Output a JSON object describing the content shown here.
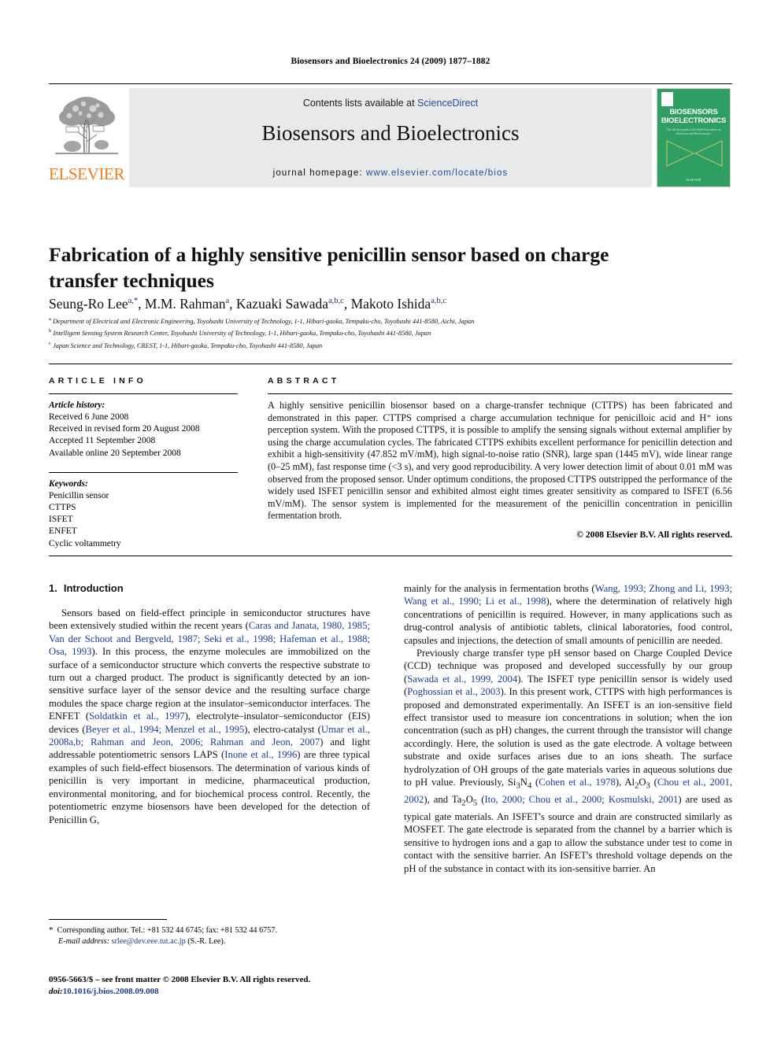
{
  "running_head": "Biosensors and Bioelectronics 24 (2009) 1877–1882",
  "masthead": {
    "publisher_name": "ELSEVIER",
    "contents_prefix": "Contents lists available at ",
    "contents_link": "ScienceDirect",
    "journal_title": "Biosensors and Bioelectronics",
    "homepage_prefix": "journal homepage: ",
    "homepage_url": "www.elsevier.com/locate/bios",
    "cover": {
      "title_line1": "BIOSENSORS",
      "title_amp": "&",
      "title_line2": "BIOELECTRONICS",
      "subtitle": "The official journal of the World Association on Biosensors and Bioelectronics",
      "footer": "ELSEVIER",
      "background_color": "#2f9e63"
    },
    "accent_orange": "#F07D18",
    "link_blue": "#1a4f9c"
  },
  "article": {
    "title": "Fabrication of a highly sensitive penicillin sensor based on charge transfer techniques",
    "authors_html": "Seung-Ro Lee<sup>a,*</sup>, M.M. Rahman<sup>a</sup>, Kazuaki Sawada<sup>a,b,c</sup>, Makoto Ishida<sup>a,b,c</sup>",
    "affiliations": [
      {
        "marker": "a",
        "text": "Department of Electrical and Electronic Engineering, Toyohashi University of Technology, 1-1, Hibari-gaoka, Tempaku-cho, Toyohashi 441-8580, Aichi, Japan"
      },
      {
        "marker": "b",
        "text": "Intelligent Sensing System Research Center, Toyohashi University of Technology, 1-1, Hibari-gaoka, Tempaku-cho, Toyohashi 441-8580, Japan"
      },
      {
        "marker": "c",
        "text": "Japan Science and Technology, CREST, 1-1, Hibari-gaoka, Tempaku-cho, Toyohashi 441-8580, Japan"
      }
    ]
  },
  "article_info": {
    "heading": "ARTICLE INFO",
    "history_label": "Article history:",
    "history": [
      "Received 6 June 2008",
      "Received in revised form 20 August 2008",
      "Accepted 11 September 2008",
      "Available online 20 September 2008"
    ],
    "keywords_label": "Keywords:",
    "keywords": [
      "Penicillin sensor",
      "CTTPS",
      "ISFET",
      "ENFET",
      "Cyclic voltammetry"
    ]
  },
  "abstract": {
    "heading": "ABSTRACT",
    "text": "A highly sensitive penicillin biosensor based on a charge-transfer technique (CTTPS) has been fabricated and demonstrated in this paper. CTTPS comprised a charge accumulation technique for penicilloic acid and H⁺ ions perception system. With the proposed CTTPS, it is possible to amplify the sensing signals without external amplifier by using the charge accumulation cycles. The fabricated CTTPS exhibits excellent performance for penicillin detection and exhibit a high-sensitivity (47.852 mV/mM), high signal-to-noise ratio (SNR), large span (1445 mV), wide linear range (0–25 mM), fast response time (<3 s), and very good reproducibility. A very lower detection limit of about 0.01 mM was observed from the proposed sensor. Under optimum conditions, the proposed CTTPS outstripped the performance of the widely used ISFET penicillin sensor and exhibited almost eight times greater sensitivity as compared to ISFET (6.56 mV/mM). The sensor system is implemented for the measurement of the penicillin concentration in penicillin fermentation broth.",
    "copyright": "© 2008 Elsevier B.V. All rights reserved."
  },
  "body": {
    "section_number": "1.",
    "section_title": "Introduction",
    "left_paragraphs_html": [
      "Sensors based on field-effect principle in semiconductor structures have been extensively studied within the recent years (<span class=\"ref\">Caras and Janata, 1980, 1985; Van der Schoot and Bergveld, 1987; Seki et al., 1998; Hafeman et al., 1988; Osa, 1993</span>). In this process, the enzyme molecules are immobilized on the surface of a semiconductor structure which converts the respective substrate to turn out a charged product. The product is significantly detected by an ion-sensitive surface layer of the sensor device and the resulting surface charge modules the space charge region at the insulator–semiconductor interfaces. The ENFET (<span class=\"ref\">Soldatkin et al., 1997</span>), electrolyte–insulator–semiconductor (EIS) devices (<span class=\"ref\">Beyer et al., 1994; Menzel et al., 1995</span>), electro-catalyst (<span class=\"ref\">Umar et al., 2008a,b; Rahman and Jeon, 2006; Rahman and Jeon, 2007</span>) and light addressable potentiometric sensors LAPS (<span class=\"ref\">Inone et al., 1996</span>) are three typical examples of such field-effect biosensors. The determination of various kinds of penicillin is very important in medicine, pharmaceutical production, environmental monitoring, and for biochemical process control. Recently, the potentiometric enzyme biosensors have been developed for the detection of Penicillin G,"
    ],
    "right_paragraphs_html": [
      "mainly for the analysis in fermentation broths (<span class=\"ref\">Wang, 1993; Zhong and Li, 1993; Wang et al., 1990; Li et al., 1998</span>), where the determination of relatively high concentrations of penicillin is required. However, in many applications such as drug-control analysis of antibiotic tablets, clinical laboratories, food control, capsules and injections, the detection of small amounts of penicillin are needed.",
      "Previously charge transfer type pH sensor based on Charge Coupled Device (CCD) technique was proposed and developed successfully by our group (<span class=\"ref\">Sawada et al., 1999, 2004</span>). The ISFET type penicillin sensor is widely used (<span class=\"ref\">Poghossian et al., 2003</span>). In this present work, CTTPS with high performances is proposed and demonstrated experimentally. An ISFET is an ion-sensitive field effect transistor used to measure ion concentrations in solution; when the ion concentration (such as pH) changes, the current through the transistor will change accordingly. Here, the solution is used as the gate electrode. A voltage between substrate and oxide surfaces arises due to an ions sheath. The surface hydrolyzation of OH groups of the gate materials varies in aqueous solutions due to pH value. Previously, Si<sub>3</sub>N<sub>4</sub> (<span class=\"ref\">Cohen et al., 1978</span>), Al<sub>2</sub>O<sub>3</sub> (<span class=\"ref\">Chou et al., 2001, 2002</span>), and Ta<sub>2</sub>O<sub>5</sub> (<span class=\"ref\">Ito, 2000; Chou et al., 2000; Kosmulski, 2001</span>) are used as typical gate materials. An ISFET's source and drain are constructed similarly as MOSFET. The gate electrode is separated from the channel by a barrier which is sensitive to hydrogen ions and a gap to allow the substance under test to come in contact with the sensitive barrier. An ISFET's threshold voltage depends on the pH of the substance in contact with its ion-sensitive barrier. An"
    ]
  },
  "footnotes": {
    "corresponding_html": "<span style=\"font-size:11px\">*</span>&nbsp; Corresponding author. Tel.: +81 532 44 6745; fax: +81 532 44 6757.",
    "email_html": "<span class=\"fn-ital\">E-mail address:</span> <span class=\"fn-link\">srlee@dev.eee.tut.ac.jp</span> (S.-R. Lee)."
  },
  "imprint": {
    "line1": "0956-5663/$ – see front matter © 2008 Elsevier B.V. All rights reserved.",
    "doi_label": "doi:",
    "doi_value": "10.1016/j.bios.2008.09.008"
  }
}
